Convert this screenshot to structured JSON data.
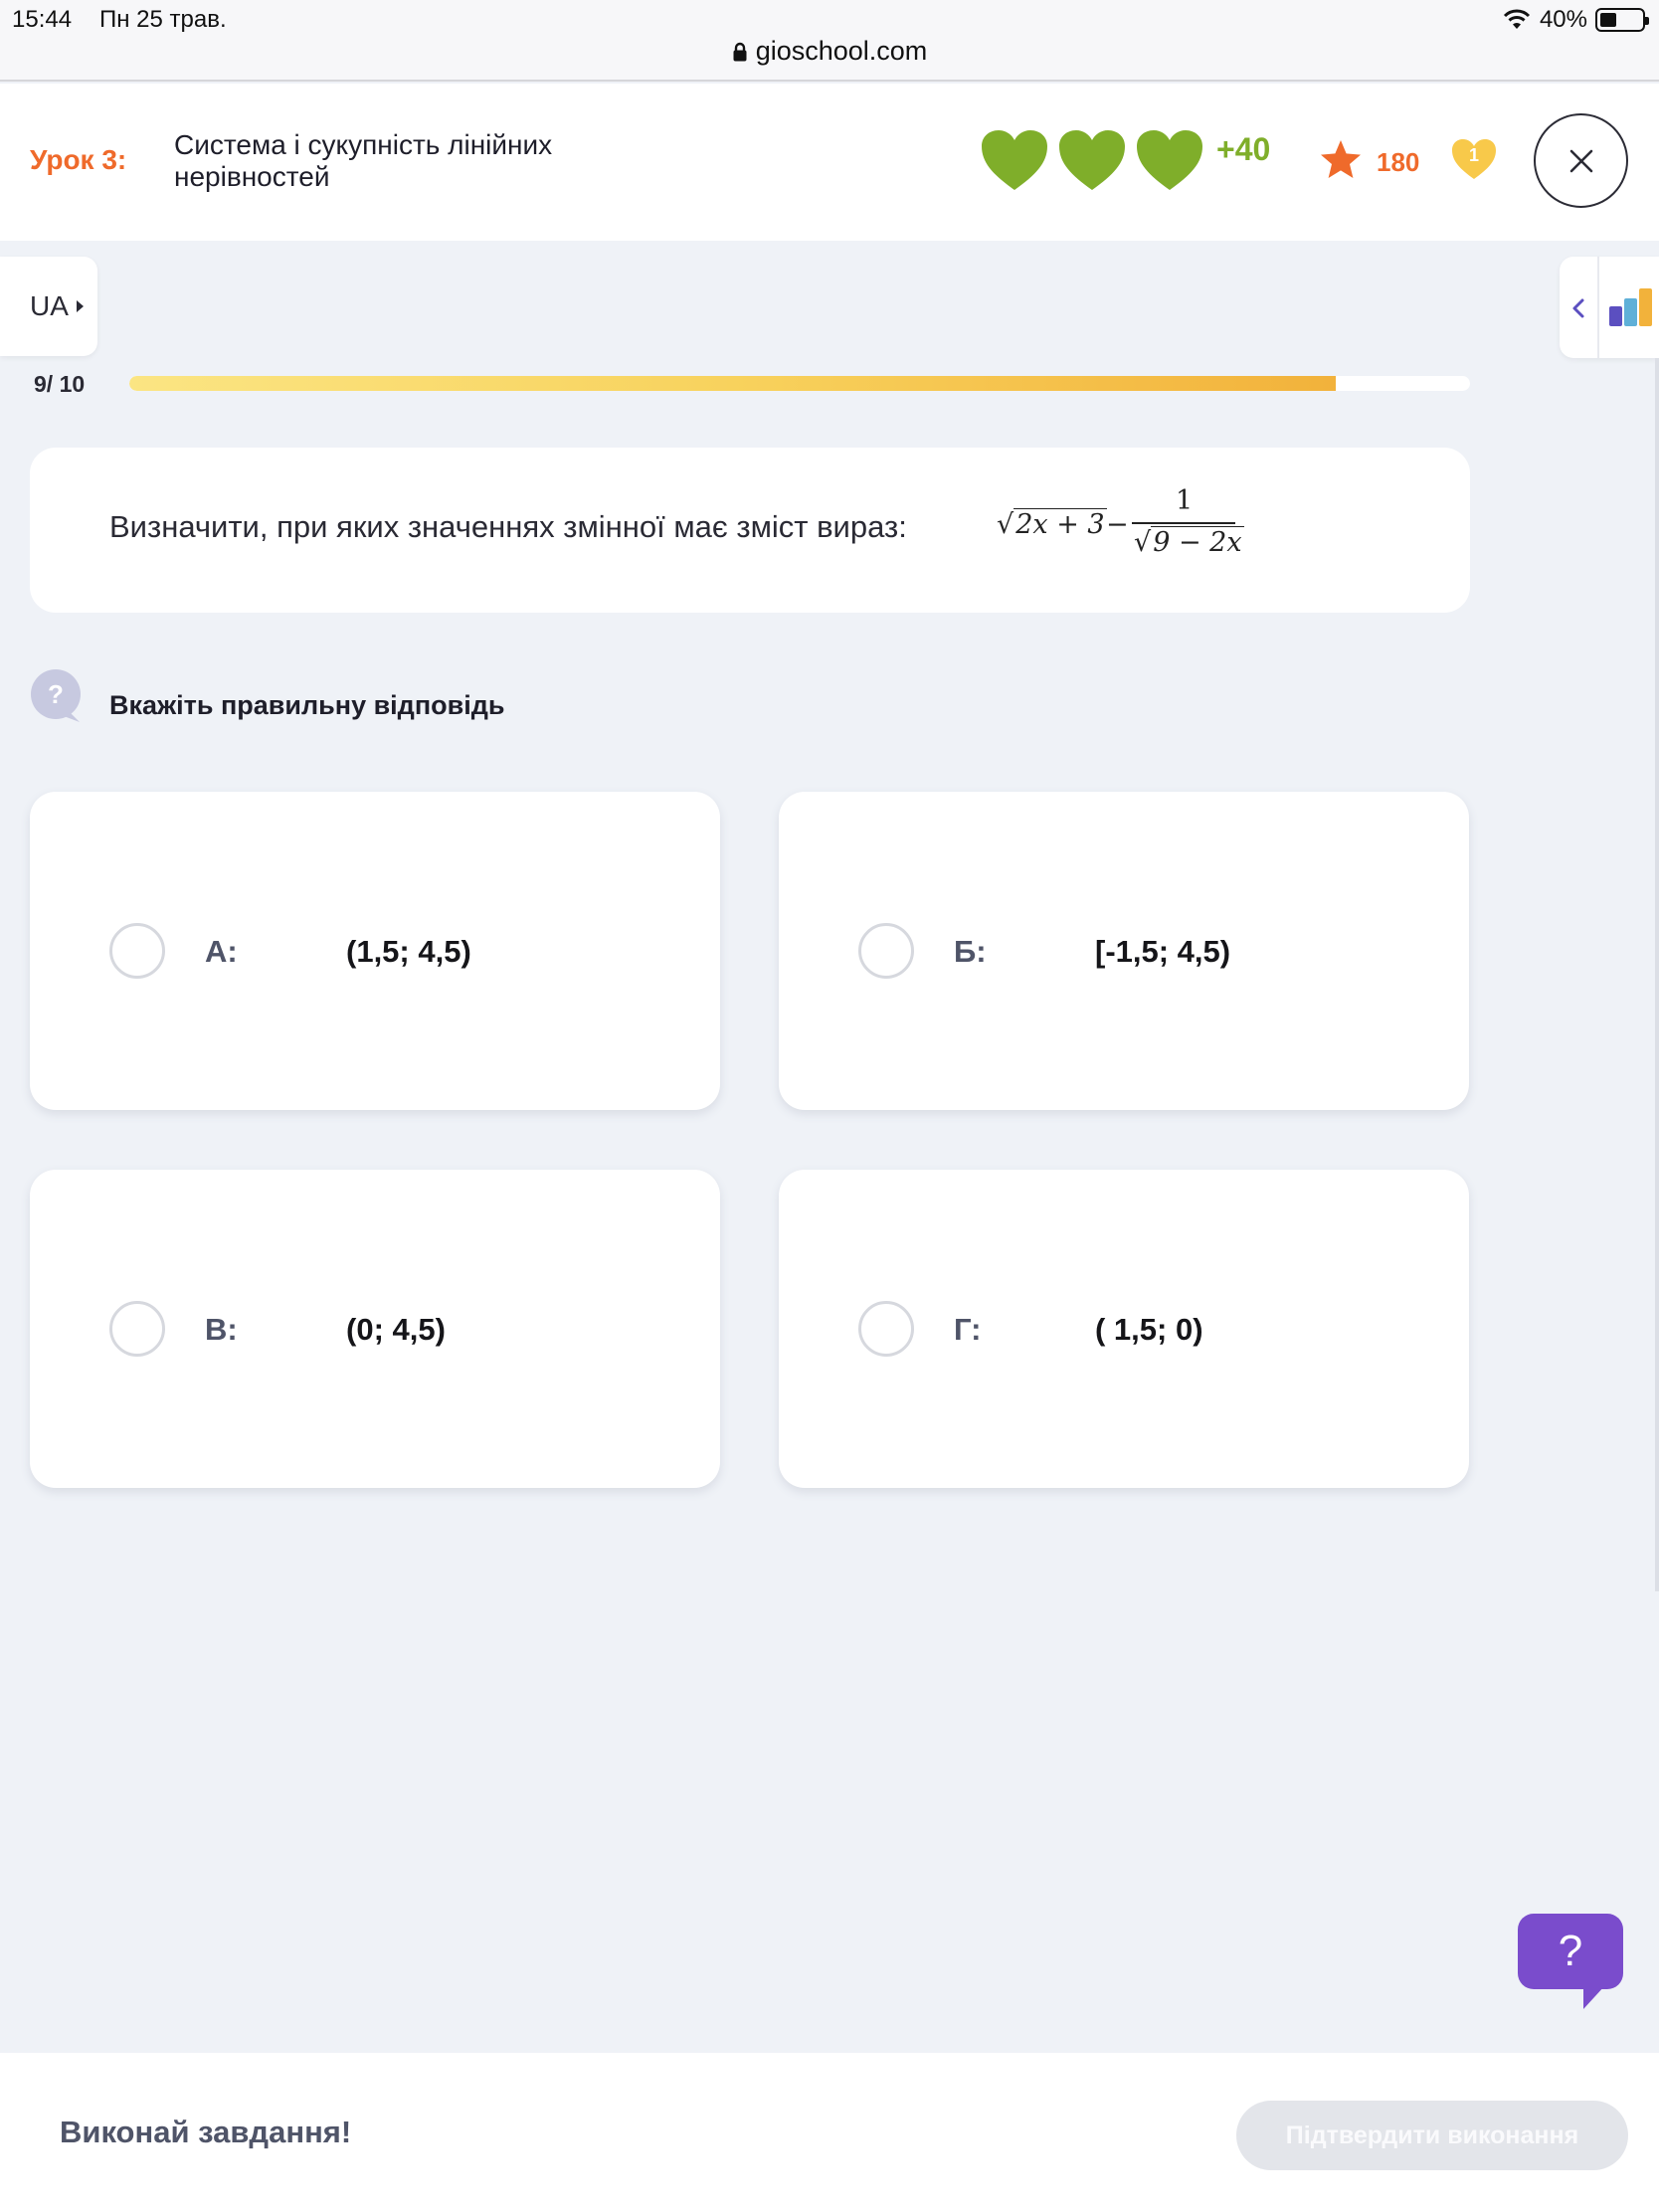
{
  "status_bar": {
    "time": "15:44",
    "date": "Пн 25 трав.",
    "battery": "40%",
    "battery_level": 0.4,
    "url": "gioschool.com"
  },
  "header": {
    "lesson_label": "Урок 3:",
    "lesson_title": "Система і сукупність лінійних нерівностей",
    "lives_count": 3,
    "bonus_points": "+40",
    "star_count": "180",
    "gold_heart_count": "1",
    "close_icon": "close-icon"
  },
  "side": {
    "language": "UA",
    "stats_icon": "bar-chart-icon"
  },
  "progress": {
    "label": "9/ 10",
    "current": 9,
    "total": 10,
    "fill_fraction": 0.9
  },
  "question": {
    "text": "Визначити, при яких значеннях змінної має зміст вираз:",
    "formula": {
      "sqrt_radicand": "2x + 3",
      "operator": "−",
      "numerator": "1",
      "denominator_radicand": "9 − 2x"
    }
  },
  "instruction": "Вкажіть правильну відповідь",
  "options": [
    {
      "letter": "А:",
      "value": "(1,5; 4,5)"
    },
    {
      "letter": "Б:",
      "value": "[-1,5; 4,5)"
    },
    {
      "letter": "В:",
      "value": "(0; 4,5)"
    },
    {
      "letter": "Г:",
      "value": "( 1,5; 0)"
    }
  ],
  "help_button": "?",
  "footer": {
    "hint": "Виконай завдання!",
    "confirm_label": "Підтвердити виконання"
  },
  "colors": {
    "accent_orange": "#ef6a2b",
    "heart_green": "#7fae2a",
    "help_purple": "#7a4ccc",
    "progress_gold": "#f2b23b",
    "gold_heart": "#f8c94a"
  }
}
